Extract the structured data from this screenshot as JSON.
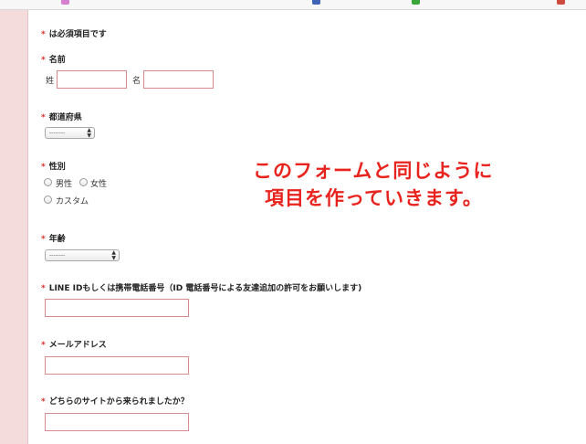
{
  "form": {
    "required_note": "は必須項目です",
    "name": {
      "label": "名前",
      "last_label": "姓",
      "first_label": "名"
    },
    "prefecture": {
      "label": "都道府県",
      "selected": "--------"
    },
    "gender": {
      "label": "性別",
      "options": [
        "男性",
        "女性",
        "カスタム"
      ]
    },
    "age": {
      "label": "年齢",
      "selected": "--------"
    },
    "line_id": {
      "label": "LINE IDもしくは携帯電話番号（ID 電話番号による友達追加の許可をお願いします)"
    },
    "email": {
      "label": "メールアドレス"
    },
    "source": {
      "label": "どちらのサイトから来られましたか？"
    },
    "required_mark": "*"
  },
  "annotation": {
    "line1": "このフォームと同じように",
    "line2": "項目を作っていきます。"
  },
  "colors": {
    "sidebar": "#f4dcdd",
    "required": "#d9312b",
    "input_border": "#d98a8e",
    "annotation": "#e8231e"
  }
}
